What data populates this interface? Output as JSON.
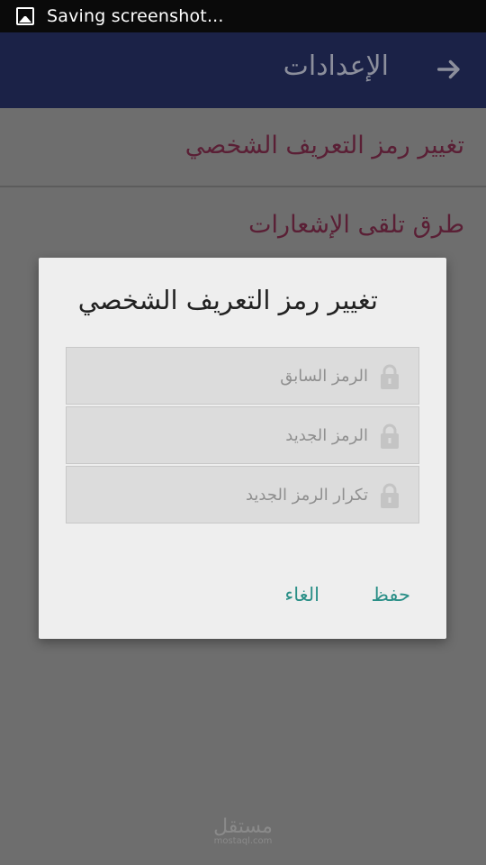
{
  "status_bar": {
    "text": "Saving screenshot..."
  },
  "app_bar": {
    "title": "الإعدادات",
    "back_icon": "arrow-right-icon"
  },
  "settings_list": [
    {
      "label": "تغيير رمز التعريف الشخصي"
    },
    {
      "label": "طرق تلقى الإشعارات"
    }
  ],
  "dialog": {
    "title": "تغيير رمز التعريف الشخصي",
    "fields": [
      {
        "placeholder": "الرمز السابق",
        "value": "",
        "icon": "lock-icon"
      },
      {
        "placeholder": "الرمز الجديد",
        "value": "",
        "icon": "lock-icon"
      },
      {
        "placeholder": "تكرار الرمز الجديد",
        "value": "",
        "icon": "lock-icon"
      }
    ],
    "save_label": "حفظ",
    "cancel_label": "الغاء"
  },
  "watermark": {
    "main": "مستقل",
    "sub": "mostaql.com"
  },
  "colors": {
    "app_bar": "#1b2247",
    "accent_buttons": "#2a8f87",
    "list_text": "#5a1f35",
    "dialog_bg": "#eeeeee"
  }
}
